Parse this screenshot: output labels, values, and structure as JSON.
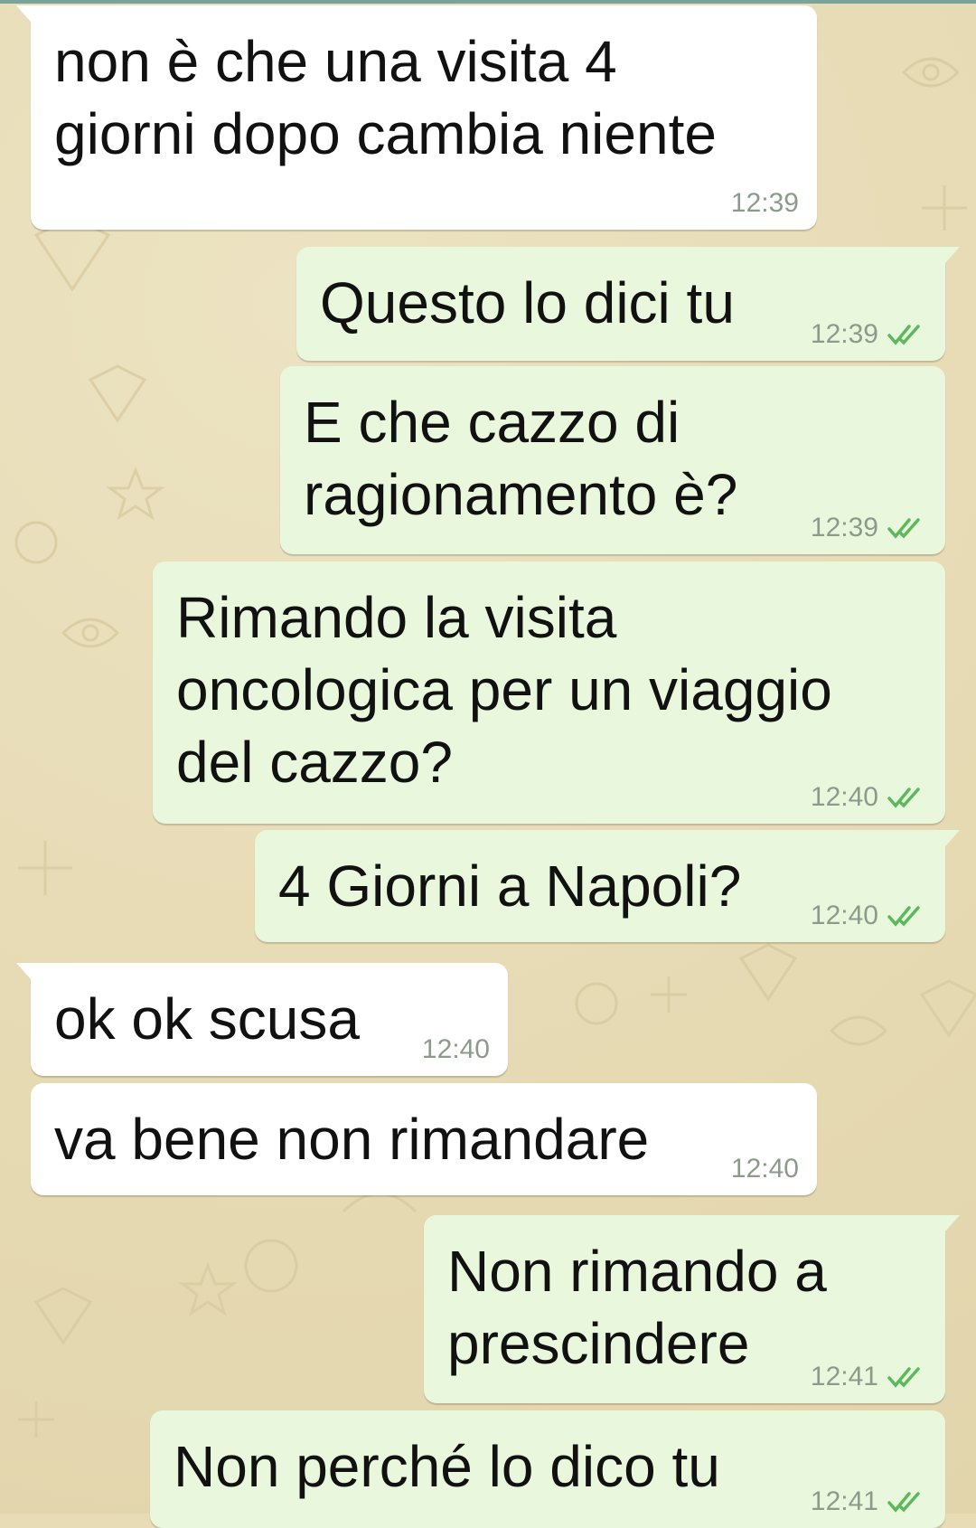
{
  "chat": {
    "messages": [
      {
        "id": "m1",
        "direction": "in",
        "text_lines": [
          "non è che una visita 4",
          "giorni dopo cambia niente"
        ],
        "time": "12:39"
      },
      {
        "id": "m2",
        "direction": "out",
        "text_lines": [
          "Questo lo dici tu"
        ],
        "time": "12:39",
        "status": "read-double-check-icon"
      },
      {
        "id": "m3",
        "direction": "out",
        "text_lines": [
          "E che cazzo di",
          "ragionamento è?"
        ],
        "time": "12:39",
        "status": "read-double-check-icon"
      },
      {
        "id": "m4",
        "direction": "out",
        "text_lines": [
          "Rimando la visita",
          "oncologica per un viaggio",
          "del cazzo?"
        ],
        "time": "12:40",
        "status": "read-double-check-icon"
      },
      {
        "id": "m5",
        "direction": "out",
        "text_lines": [
          "4 Giorni a Napoli?"
        ],
        "time": "12:40",
        "status": "read-double-check-icon"
      },
      {
        "id": "m6",
        "direction": "in",
        "text_lines": [
          "ok ok scusa"
        ],
        "time": "12:40"
      },
      {
        "id": "m7",
        "direction": "in",
        "text_lines": [
          "va bene non rimandare"
        ],
        "time": "12:40"
      },
      {
        "id": "m8",
        "direction": "out",
        "text_lines": [
          "Non rimando a",
          "prescindere"
        ],
        "time": "12:41",
        "status": "read-double-check-icon"
      },
      {
        "id": "m9",
        "direction": "out",
        "text_lines": [
          "Non perché lo dico tu"
        ],
        "time": "12:41",
        "status": "read-double-check-icon"
      }
    ]
  },
  "colors": {
    "wallpaper": "#e7dcb6",
    "incoming_bubble": "#ffffff",
    "outgoing_bubble": "#e9f8dd",
    "read_ticks": "#5cb85c",
    "timestamp": "#8c9a8c"
  }
}
